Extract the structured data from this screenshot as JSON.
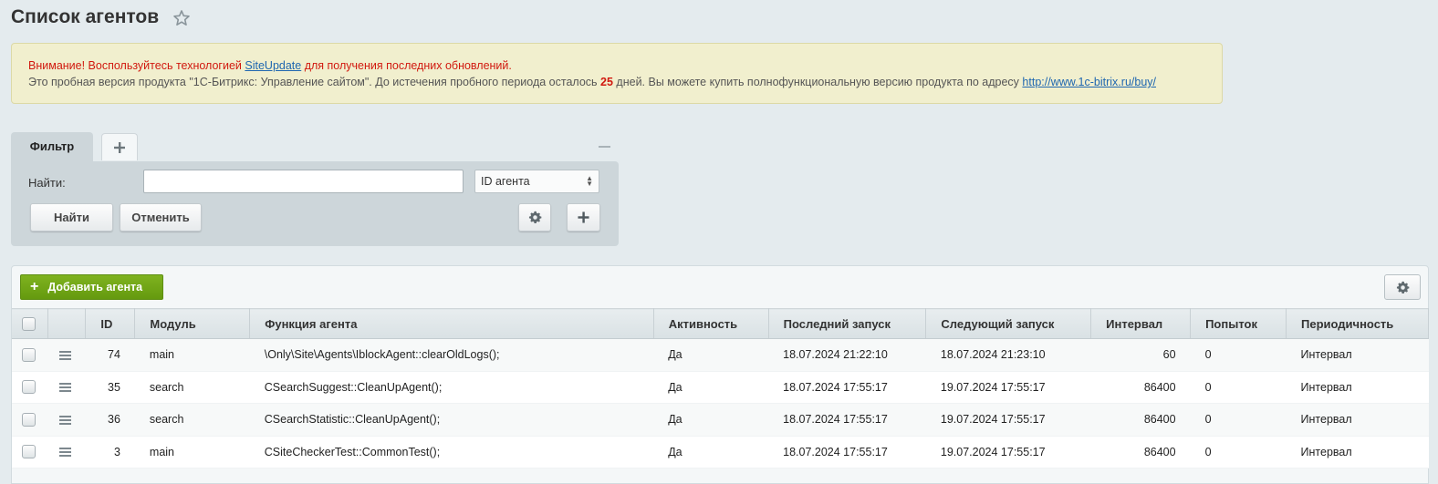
{
  "page": {
    "title": "Список агентов"
  },
  "notice": {
    "warning_prefix": "Внимание! Воспользуйтесь технологией ",
    "warning_link": "SiteUpdate",
    "warning_suffix": " для получения последних обновлений.",
    "info_prefix": "Это пробная версия продукта \"1С-Битрикс: Управление сайтом\". До истечения пробного периода осталось ",
    "info_days": "25",
    "info_middle": " дней. Вы можете купить полнофункциональную версию продукта по адресу ",
    "info_link": "http://www.1c-bitrix.ru/buy/"
  },
  "filter": {
    "tab_label": "Фильтр",
    "find_label": "Найти:",
    "search_value": "",
    "select_value": "ID агента",
    "find_button": "Найти",
    "cancel_button": "Отменить"
  },
  "list": {
    "add_button": "Добавить агента",
    "columns": [
      "ID",
      "Модуль",
      "Функция агента",
      "Активность",
      "Последний запуск",
      "Следующий запуск",
      "Интервал",
      "Попыток",
      "Периодичность"
    ],
    "rows": [
      {
        "id": "74",
        "module": "main",
        "function": "\\Only\\Site\\Agents\\IblockAgent::clearOldLogs();",
        "active": "Да",
        "last_run": "18.07.2024 21:22:10",
        "next_run": "18.07.2024 21:23:10",
        "interval": "60",
        "attempts": "0",
        "periodicity": "Интервал"
      },
      {
        "id": "35",
        "module": "search",
        "function": "CSearchSuggest::CleanUpAgent();",
        "active": "Да",
        "last_run": "18.07.2024 17:55:17",
        "next_run": "19.07.2024 17:55:17",
        "interval": "86400",
        "attempts": "0",
        "periodicity": "Интервал"
      },
      {
        "id": "36",
        "module": "search",
        "function": "CSearchStatistic::CleanUpAgent();",
        "active": "Да",
        "last_run": "18.07.2024 17:55:17",
        "next_run": "19.07.2024 17:55:17",
        "interval": "86400",
        "attempts": "0",
        "periodicity": "Интервал"
      },
      {
        "id": "3",
        "module": "main",
        "function": "CSiteCheckerTest::CommonTest();",
        "active": "Да",
        "last_run": "18.07.2024 17:55:17",
        "next_run": "19.07.2024 17:55:17",
        "interval": "86400",
        "attempts": "0",
        "periodicity": "Интервал"
      }
    ]
  },
  "icons": {
    "star": "star-icon",
    "gear": "gear-icon",
    "plus": "plus-icon",
    "menu": "hamburger-icon"
  },
  "colors": {
    "add_button": "#72a818",
    "warning_text": "#d1190f",
    "link": "#2067b0"
  }
}
